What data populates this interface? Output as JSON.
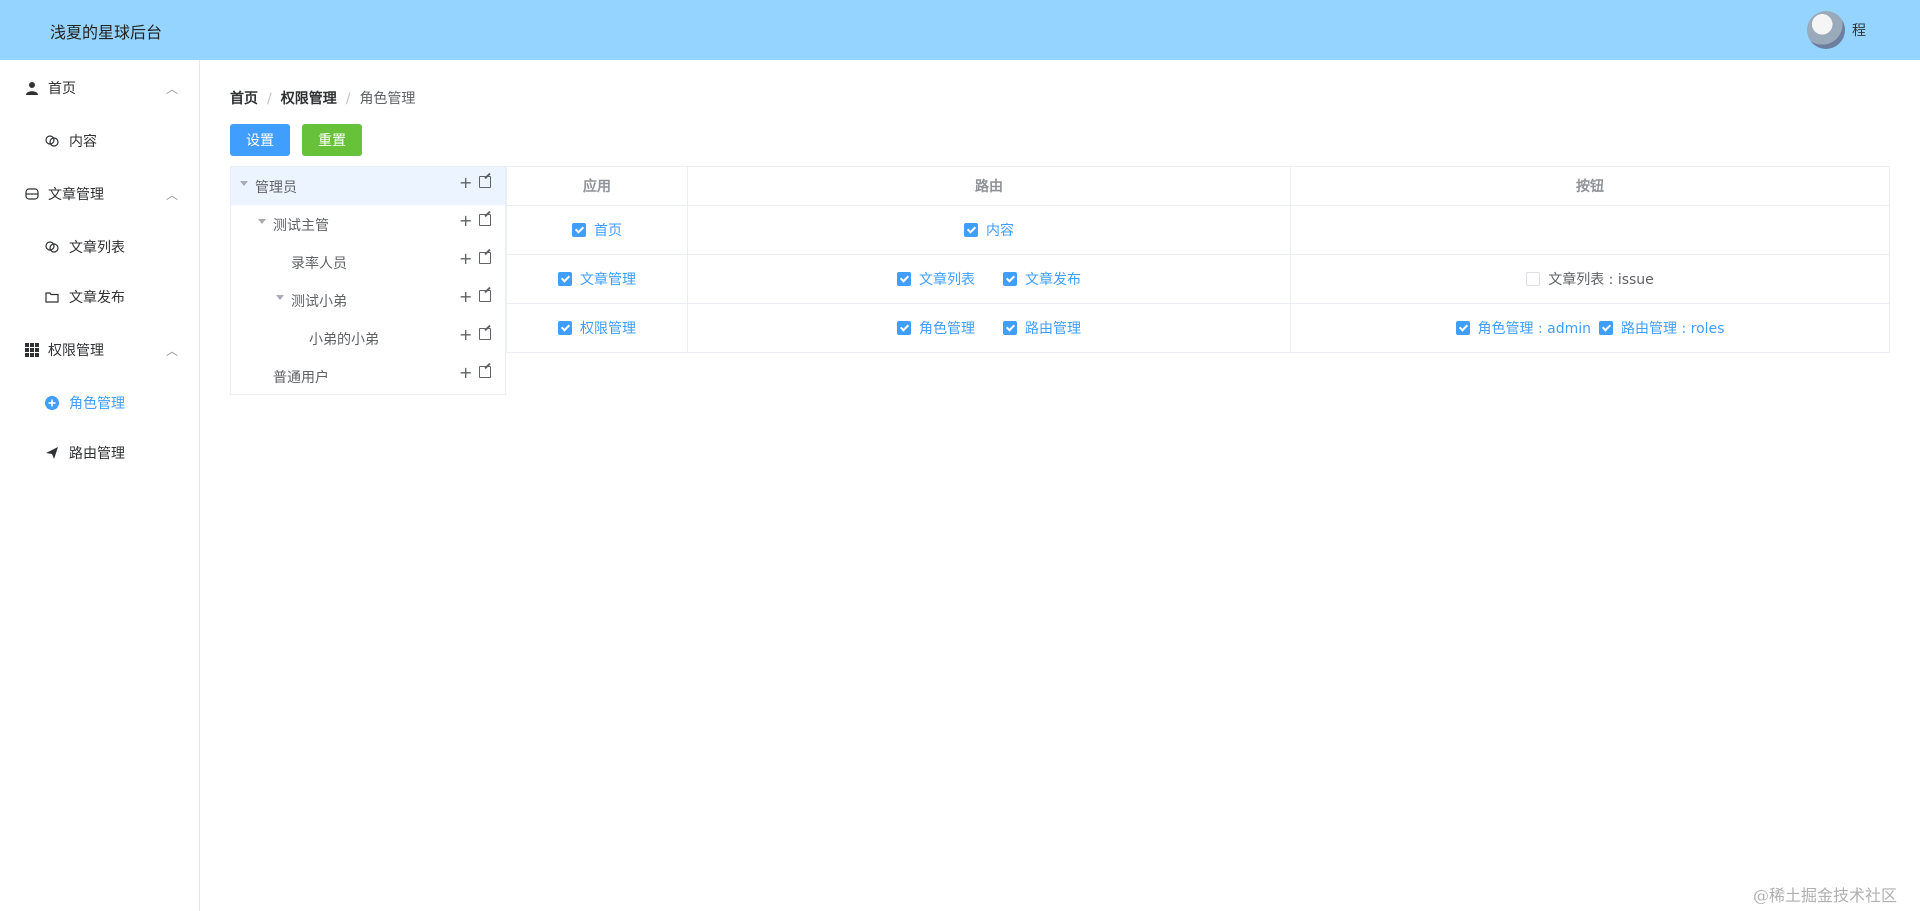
{
  "header": {
    "title": "浅夏的星球后台",
    "user_name": "程"
  },
  "sidebar": {
    "groups": [
      {
        "label": "首页",
        "icon": "user-icon",
        "children": [
          {
            "label": "内容",
            "icon": "link-icon"
          }
        ]
      },
      {
        "label": "文章管理",
        "icon": "stack-icon",
        "children": [
          {
            "label": "文章列表",
            "icon": "link-icon"
          },
          {
            "label": "文章发布",
            "icon": "folder-icon"
          }
        ]
      },
      {
        "label": "权限管理",
        "icon": "grid-icon",
        "children": [
          {
            "label": "角色管理",
            "icon": "plus-circle-icon",
            "active": true
          },
          {
            "label": "路由管理",
            "icon": "send-icon"
          }
        ]
      }
    ]
  },
  "breadcrumb": {
    "items": [
      "首页",
      "权限管理"
    ],
    "separator": "/",
    "current": "角色管理"
  },
  "buttons": {
    "set": "设置",
    "reset": "重置"
  },
  "tree": {
    "nodes": [
      {
        "label": "管理员",
        "level": 0,
        "expanded": true,
        "selected": true
      },
      {
        "label": "测试主管",
        "level": 1,
        "expanded": true
      },
      {
        "label": "录率人员",
        "level": 2
      },
      {
        "label": "测试小弟",
        "level": 2,
        "expanded": true
      },
      {
        "label": "小弟的小弟",
        "level": 3
      },
      {
        "label": "普通用户",
        "level": 1
      }
    ]
  },
  "table": {
    "headers": [
      "应用",
      "路由",
      "按钮"
    ],
    "rows": [
      {
        "app": {
          "label": "首页",
          "checked": true
        },
        "routes": [
          {
            "label": "内容",
            "checked": true
          }
        ],
        "buttons": []
      },
      {
        "app": {
          "label": "文章管理",
          "checked": true
        },
        "routes": [
          {
            "label": "文章列表",
            "checked": true
          },
          {
            "label": "文章发布",
            "checked": true
          }
        ],
        "buttons": [
          {
            "label": "文章列表 : issue",
            "checked": false
          }
        ]
      },
      {
        "app": {
          "label": "权限管理",
          "checked": true
        },
        "routes": [
          {
            "label": "角色管理",
            "checked": true
          },
          {
            "label": "路由管理",
            "checked": true
          }
        ],
        "buttons": [
          {
            "label": "角色管理 : admin",
            "checked": true
          },
          {
            "label": "路由管理 : roles",
            "checked": true
          }
        ]
      }
    ]
  },
  "watermark": "@稀土掘金技术社区",
  "colors": {
    "header_bg": "#94d4ff",
    "primary": "#409eff",
    "success": "#67c23a"
  }
}
